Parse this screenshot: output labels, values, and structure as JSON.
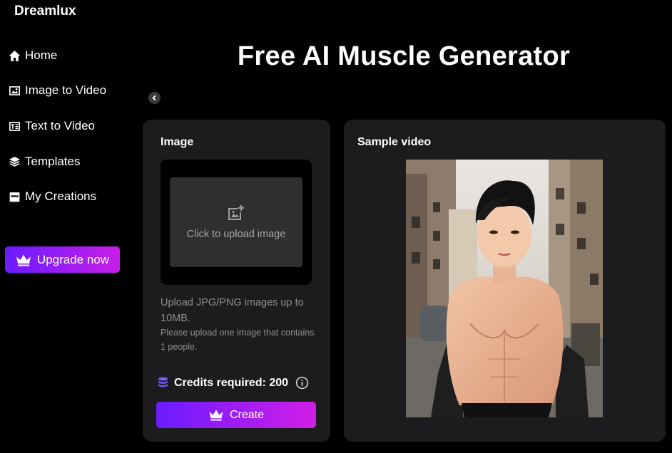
{
  "brand": {
    "name": "Dreamlux"
  },
  "sidebar": {
    "items": [
      {
        "label": "Home",
        "icon": "home-icon"
      },
      {
        "label": "Image to Video",
        "icon": "image-icon"
      },
      {
        "label": "Text to Video",
        "icon": "text-video-icon"
      },
      {
        "label": "Templates",
        "icon": "layers-icon"
      },
      {
        "label": "My Creations",
        "icon": "folder-icon"
      }
    ],
    "upgrade_label": "Upgrade now"
  },
  "main": {
    "title": "Free AI Muscle Generator",
    "image_panel": {
      "title": "Image",
      "upload_label": "Click to upload image",
      "hint_primary": "Upload JPG/PNG images up to 10MB.",
      "hint_secondary": "Please upload one image that contains 1 people.",
      "credits_label": "Credits required: 200",
      "create_label": "Create"
    },
    "sample_panel": {
      "title": "Sample video"
    }
  },
  "colors": {
    "background": "#000000",
    "panel": "#1c1c1e",
    "accent_start": "#6a1cff",
    "accent_end": "#d21ee6",
    "credit_icon": "#7b5cff"
  }
}
